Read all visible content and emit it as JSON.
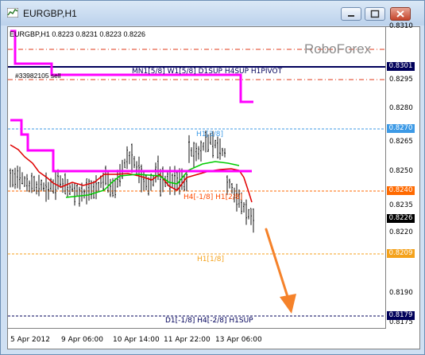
{
  "window": {
    "title": "EURGBP,H1"
  },
  "chart": {
    "header": "EURGBP,H1  0.8223 0.8231 0.8223 0.8226",
    "brand": "RoboForex",
    "order_label": "#33982105 sell",
    "price_labels": [
      "0.8310",
      "0.8295",
      "0.8280",
      "0.8265",
      "0.8250",
      "0.8235",
      "0.8220",
      "0.8190",
      "0.8175"
    ],
    "price_badges": [
      {
        "value": "0.8301",
        "color": "#00005a"
      },
      {
        "value": "0.8270",
        "color": "#3d9ae6"
      },
      {
        "value": "0.8240",
        "color": "#ff6a00"
      },
      {
        "value": "0.8226",
        "color": "#000000"
      },
      {
        "value": "0.8209",
        "color": "#f4a21c"
      },
      {
        "value": "0.8179",
        "color": "#00005a"
      }
    ],
    "time_labels": [
      "5 Apr 2012",
      "9 Apr 06:00",
      "10 Apr 14:00",
      "11 Apr 22:00",
      "13 Apr 06:00"
    ],
    "level_labels": {
      "top": "MN1[5/8] W1[5/8] D1SUP H4SUP H1PIVOT",
      "h1_3_8": "H1[3/8]",
      "h1_mid": "H4[-1/8] H1[2/8]",
      "h1_1_8": "H1[1/8]",
      "bottom": "D1[-1/8] H4[-2/8] H1SUP"
    },
    "colors": {
      "magenta": "#ff00ff",
      "red": "#e00000",
      "green": "#00cc00",
      "navy": "#00005a",
      "orange_arrow": "#f5822a"
    }
  }
}
